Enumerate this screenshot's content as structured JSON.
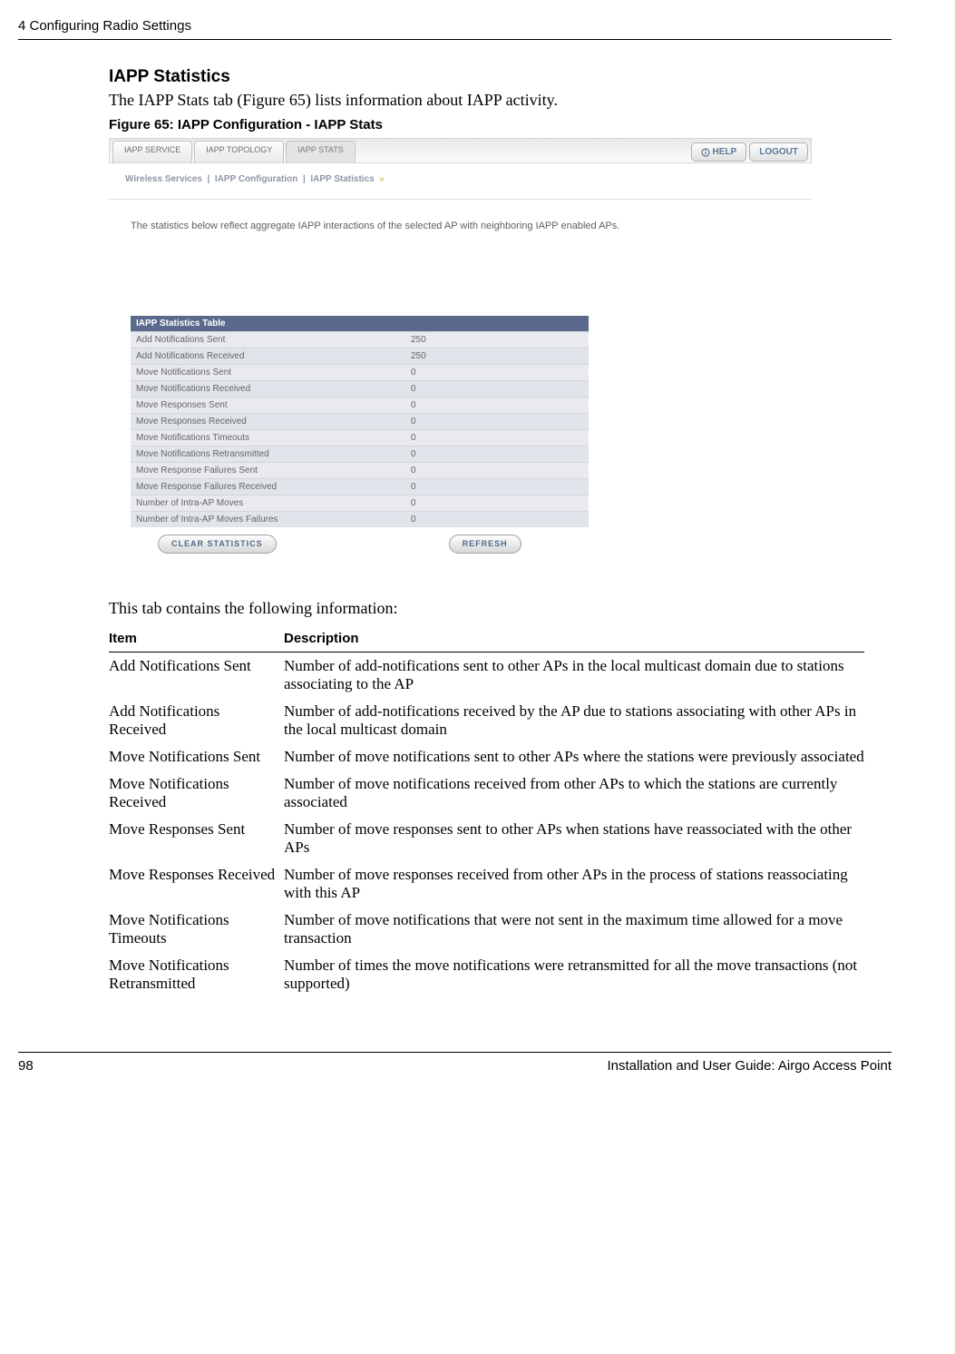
{
  "header": {
    "chapter": "4  Configuring Radio Settings"
  },
  "section": {
    "title": "IAPP Statistics",
    "intro": "The IAPP Stats tab (Figure 65) lists information about IAPP activity.",
    "figure_label": "Figure 65:     IAPP Configuration - IAPP Stats"
  },
  "screenshot": {
    "tabs": {
      "service": "IAPP SERVICE",
      "topology": "IAPP TOPOLOGY",
      "stats": "IAPP STATS"
    },
    "top_buttons": {
      "help": "HELP",
      "logout": "LOGOUT"
    },
    "breadcrumb": {
      "a": "Wireless Services",
      "b": "IAPP Configuration",
      "c": "IAPP Statistics"
    },
    "panel_description": "The statistics below reflect aggregate IAPP interactions of the selected AP with neighboring IAPP enabled APs.",
    "table_title": "IAPP Statistics Table",
    "rows": [
      {
        "label": "Add Notifications Sent",
        "value": "250"
      },
      {
        "label": "Add Notifications Received",
        "value": "250"
      },
      {
        "label": "Move Notifications Sent",
        "value": "0"
      },
      {
        "label": "Move Notifications Received",
        "value": "0"
      },
      {
        "label": "Move Responses Sent",
        "value": "0"
      },
      {
        "label": "Move Responses Received",
        "value": "0"
      },
      {
        "label": "Move Notifications Timeouts",
        "value": "0"
      },
      {
        "label": "Move Notifications Retransmitted",
        "value": "0"
      },
      {
        "label": "Move Response Failures Sent",
        "value": "0"
      },
      {
        "label": "Move Response Failures Received",
        "value": "0"
      },
      {
        "label": "Number of Intra-AP Moves",
        "value": "0"
      },
      {
        "label": "Number of Intra-AP Moves Failures",
        "value": "0"
      }
    ],
    "buttons": {
      "clear": "CLEAR STATISTICS",
      "refresh": "REFRESH"
    }
  },
  "tab_info_intro": "This tab contains the following information:",
  "columns": {
    "item": "Item",
    "desc": "Description"
  },
  "definitions": [
    {
      "item": "Add Notifications Sent",
      "desc": "Number of add-notifications sent to other APs in the local multicast domain due to stations associating to the AP"
    },
    {
      "item": "Add Notifications Received",
      "desc": "Number of add-notifications received by the AP due to stations associating with other APs in the local multicast domain"
    },
    {
      "item": "Move Notifications Sent",
      "desc": "Number of move notifications sent to other APs where the stations were previously associated"
    },
    {
      "item": "Move Notifications Received",
      "desc": "Number of move notifications received from other APs to which the stations are currently associated"
    },
    {
      "item": "Move Responses Sent",
      "desc": "Number of move responses sent to other APs when stations have reassociated with the other APs"
    },
    {
      "item": "Move Responses Received",
      "desc": "Number of move responses received from other APs in the process of stations reassociating with this AP"
    },
    {
      "item": "Move Notifications Timeouts",
      "desc": "Number of move notifications that were not sent in the maximum time allowed for a move transaction"
    },
    {
      "item": "Move Notifications Retransmitted",
      "desc": "Number of times the move notifications were retransmitted for all the move transactions (not supported)"
    }
  ],
  "footer": {
    "page": "98",
    "title": "Installation and User Guide: Airgo Access Point"
  }
}
